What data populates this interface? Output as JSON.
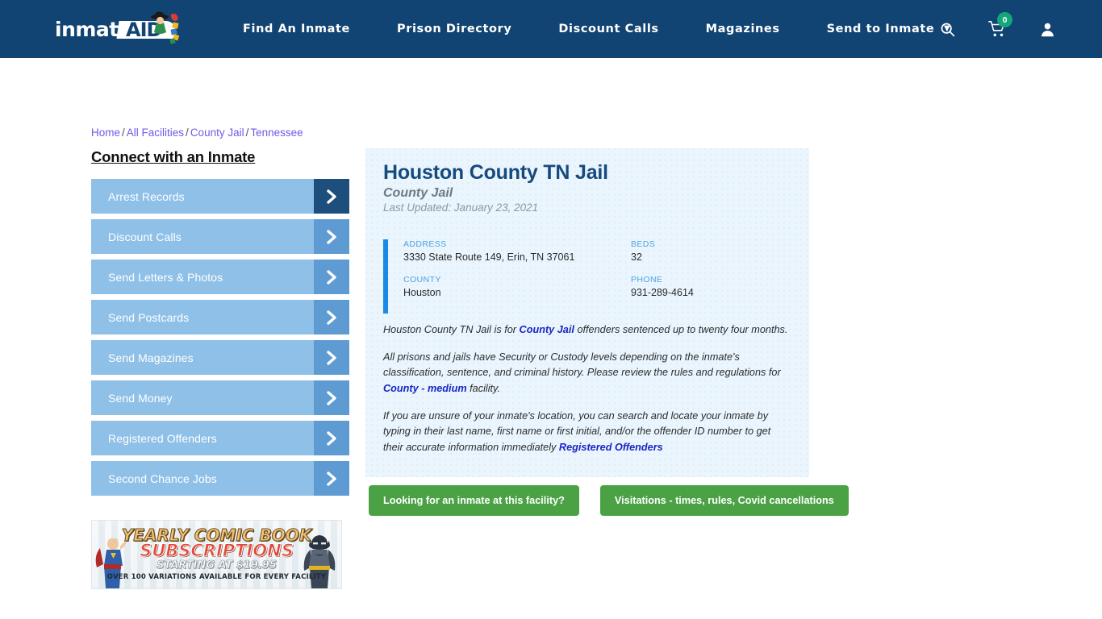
{
  "header": {
    "logo": {
      "brand_prefix": "inmate",
      "brand_suffix": "AID",
      "icon": "inmateaid-logo-character"
    },
    "nav": [
      {
        "label": "Find An Inmate",
        "has_caret": false
      },
      {
        "label": "Prison Directory",
        "has_caret": false
      },
      {
        "label": "Discount Calls",
        "has_caret": false
      },
      {
        "label": "Magazines",
        "has_caret": false
      },
      {
        "label": "Send to Inmate",
        "has_caret": true
      }
    ],
    "icons": {
      "search": "search-icon",
      "cart": "shopping-cart-icon",
      "cart_count": "0",
      "account": "user-account-icon"
    },
    "colors": {
      "bar": "#114472",
      "badge": "#15a67a"
    }
  },
  "breadcrumb": {
    "items": [
      "Home",
      "All Facilities",
      "County Jail",
      "Tennessee"
    ],
    "separator": "/"
  },
  "sidebar": {
    "title": "Connect with an Inmate",
    "items": [
      {
        "label": "Arrest Records",
        "active": true
      },
      {
        "label": "Discount Calls",
        "active": false
      },
      {
        "label": "Send Letters & Photos",
        "active": false
      },
      {
        "label": "Send Postcards",
        "active": false
      },
      {
        "label": "Send Magazines",
        "active": false
      },
      {
        "label": "Send Money",
        "active": false
      },
      {
        "label": "Registered Offenders",
        "active": false
      },
      {
        "label": "Second Chance Jobs",
        "active": false
      }
    ],
    "chevron_icon": "chevron-right-icon",
    "colors": {
      "item_bg": "#8fc0e8",
      "chevron_bg": "#5f9bd3",
      "chevron_bg_active": "#1d4f7c"
    }
  },
  "ad": {
    "line1": "YEARLY COMIC BOOK",
    "line2": "SUBSCRIPTIONS",
    "line3": "STARTING AT $19.95",
    "line4": "OVER 100 VARIATIONS AVAILABLE FOR EVERY FACILITY",
    "hero_left": "superman-figure",
    "hero_right": "batman-figure"
  },
  "facility": {
    "name": "Houston County TN Jail",
    "type": "County Jail",
    "last_updated": "Last Updated: January 23, 2021",
    "info": [
      {
        "label": "ADDRESS",
        "value": "3330 State Route 149, Erin, TN 37061"
      },
      {
        "label": "BEDS",
        "value": "32"
      },
      {
        "label": "COUNTY",
        "value": "Houston"
      },
      {
        "label": "PHONE",
        "value": "931-289-4614"
      }
    ],
    "paragraphs": [
      {
        "parts": [
          {
            "text": "Houston County TN Jail is for ",
            "link": false
          },
          {
            "text": "County Jail",
            "link": true
          },
          {
            "text": " offenders sentenced up to twenty four months.",
            "link": false
          }
        ]
      },
      {
        "parts": [
          {
            "text": "All prisons and jails have Security or Custody levels depending on the inmate's classification, sentence, and criminal history. Please review the rules and regulations for ",
            "link": false
          },
          {
            "text": "County - medium",
            "link": true
          },
          {
            "text": " facility.",
            "link": false
          }
        ]
      },
      {
        "parts": [
          {
            "text": "If you are unsure of your inmate's location, you can search and locate your inmate by typing in their last name, first name or first initial, and/or the offender ID number to get their accurate information immediately ",
            "link": false
          },
          {
            "text": "Registered Offenders",
            "link": true
          }
        ]
      }
    ],
    "colors": {
      "card_bg": "#eaf5fd",
      "accent_bar": "#1a8ae5",
      "title": "#164a7e",
      "link": "#1a26c4"
    }
  },
  "buttons": [
    {
      "label": "Looking for an inmate at this facility?"
    },
    {
      "label": "Visitations - times, rules, Covid cancellations"
    }
  ],
  "button_color": "#4aa245"
}
